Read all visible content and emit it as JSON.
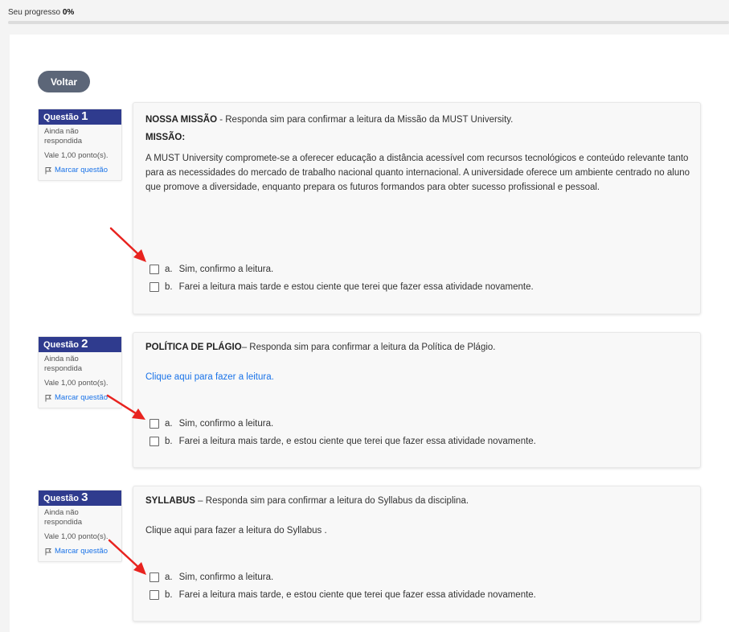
{
  "progress": {
    "label": "Seu progresso",
    "value": "0%",
    "fraction": 0
  },
  "back_button": "Voltar",
  "questions": [
    {
      "header_label": "Questão",
      "number": "1",
      "status": "Ainda não respondida",
      "grade": "Vale 1,00 ponto(s).",
      "flag": "Marcar questão",
      "title": "NOSSA MISSÃO",
      "prompt": " - Responda sim para confirmar a leitura da Missão da MUST University.",
      "subtitle": "MISSÃO:",
      "body": "A MUST University compromete-se a oferecer educação a distância acessível com recursos tecnológicos e conteúdo relevante tanto para as necessidades do mercado de trabalho nacional quanto internacional. A universidade oferece um ambiente centrado no aluno que promove a diversidade, enquanto prepara os futuros formandos para obter sucesso profissional e pessoal.",
      "answers": [
        {
          "letter": "a.",
          "text": "Sim, confirmo a leitura."
        },
        {
          "letter": "b.",
          "text": "Farei a leitura mais tarde e estou ciente que terei que fazer essa atividade novamente."
        }
      ]
    },
    {
      "header_label": "Questão",
      "number": "2",
      "status": "Ainda não respondida",
      "grade": "Vale 1,00 ponto(s).",
      "flag": "Marcar questão",
      "title": "POLÍTICA DE PLÁGIO",
      "prompt": "– Responda sim para confirmar a leitura da Política de Plágio.",
      "link": "Clique aqui para fazer a leitura.",
      "answers": [
        {
          "letter": "a.",
          "text": "Sim, confirmo a leitura."
        },
        {
          "letter": "b.",
          "text": "Farei a leitura mais tarde, e estou ciente que terei que fazer essa atividade novamente."
        }
      ]
    },
    {
      "header_label": "Questão",
      "number": "3",
      "status": "Ainda não respondida",
      "grade": "Vale 1,00 ponto(s).",
      "flag": "Marcar questão",
      "title": "SYLLABUS",
      "prompt": " – Responda sim para confirmar a leitura do Syllabus da disciplina.",
      "link": "Clique aqui para fazer a leitura do Syllabus .",
      "answers": [
        {
          "letter": "a.",
          "text": "Sim, confirmo a leitura."
        },
        {
          "letter": "b.",
          "text": "Farei a leitura mais tarde, e estou ciente que terei que fazer essa atividade novamente."
        }
      ]
    }
  ],
  "colors": {
    "header_blue": "#2f3b8e",
    "link_blue": "#1a73e8",
    "button_gray": "#5c6678",
    "arrow_red": "#e8231f"
  }
}
